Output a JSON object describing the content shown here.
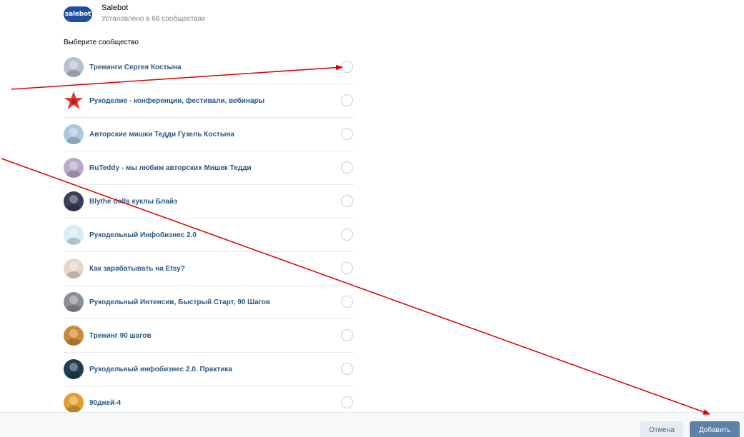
{
  "app": {
    "logo_text": "salebot",
    "name": "Salebot",
    "installed": "Установлено в 68 сообществах"
  },
  "choose_label": "Выберите сообщество",
  "communities": [
    {
      "name": "Тренинги Сергея Костына",
      "avatar": "person-avatar-icon",
      "color": "#b8c0cc"
    },
    {
      "name": "Рукоделие - конференции, фестивали, вебинары",
      "avatar": "red-star-icon",
      "color": "#e03a3a"
    },
    {
      "name": "Авторские мишки Тедди Гузель Костына",
      "avatar": "teddy-bear-icon",
      "color": "#a9c9de"
    },
    {
      "name": "RuTeddy - мы любим авторских Мишек Тедди",
      "avatar": "teddy-bear-icon",
      "color": "#b9a8c9"
    },
    {
      "name": "Blythe dolls куклы Блайз",
      "avatar": "doll-icon",
      "color": "#3a3f5a"
    },
    {
      "name": "Рукодельный Инфобизнес 2.0",
      "avatar": "snowman-icon",
      "color": "#d8ecf4"
    },
    {
      "name": "Как зарабатывать на Etsy?",
      "avatar": "etsy-logo-icon",
      "color": "#e8d7c8"
    },
    {
      "name": "Рукодельный Интенсив, Быстрый Старт, 90 Шагов",
      "avatar": "workspace-icon",
      "color": "#8c8f94"
    },
    {
      "name": "Тренинг 90 шагов",
      "avatar": "sunset-people-icon",
      "color": "#c98a3a"
    },
    {
      "name": "Рукодельный инфобизнес 2.0. Практика",
      "avatar": "text-logo-icon",
      "color": "#1e3d4f"
    },
    {
      "name": "90дней-4",
      "avatar": "sunset-people-icon",
      "color": "#e0a030"
    }
  ],
  "footer": {
    "cancel_label": "Отмена",
    "add_label": "Добавить"
  },
  "colors": {
    "link": "#2a5885",
    "arrow": "#e00000",
    "add_button": "#5e81a8",
    "cancel_button": "#e5ebf1"
  }
}
